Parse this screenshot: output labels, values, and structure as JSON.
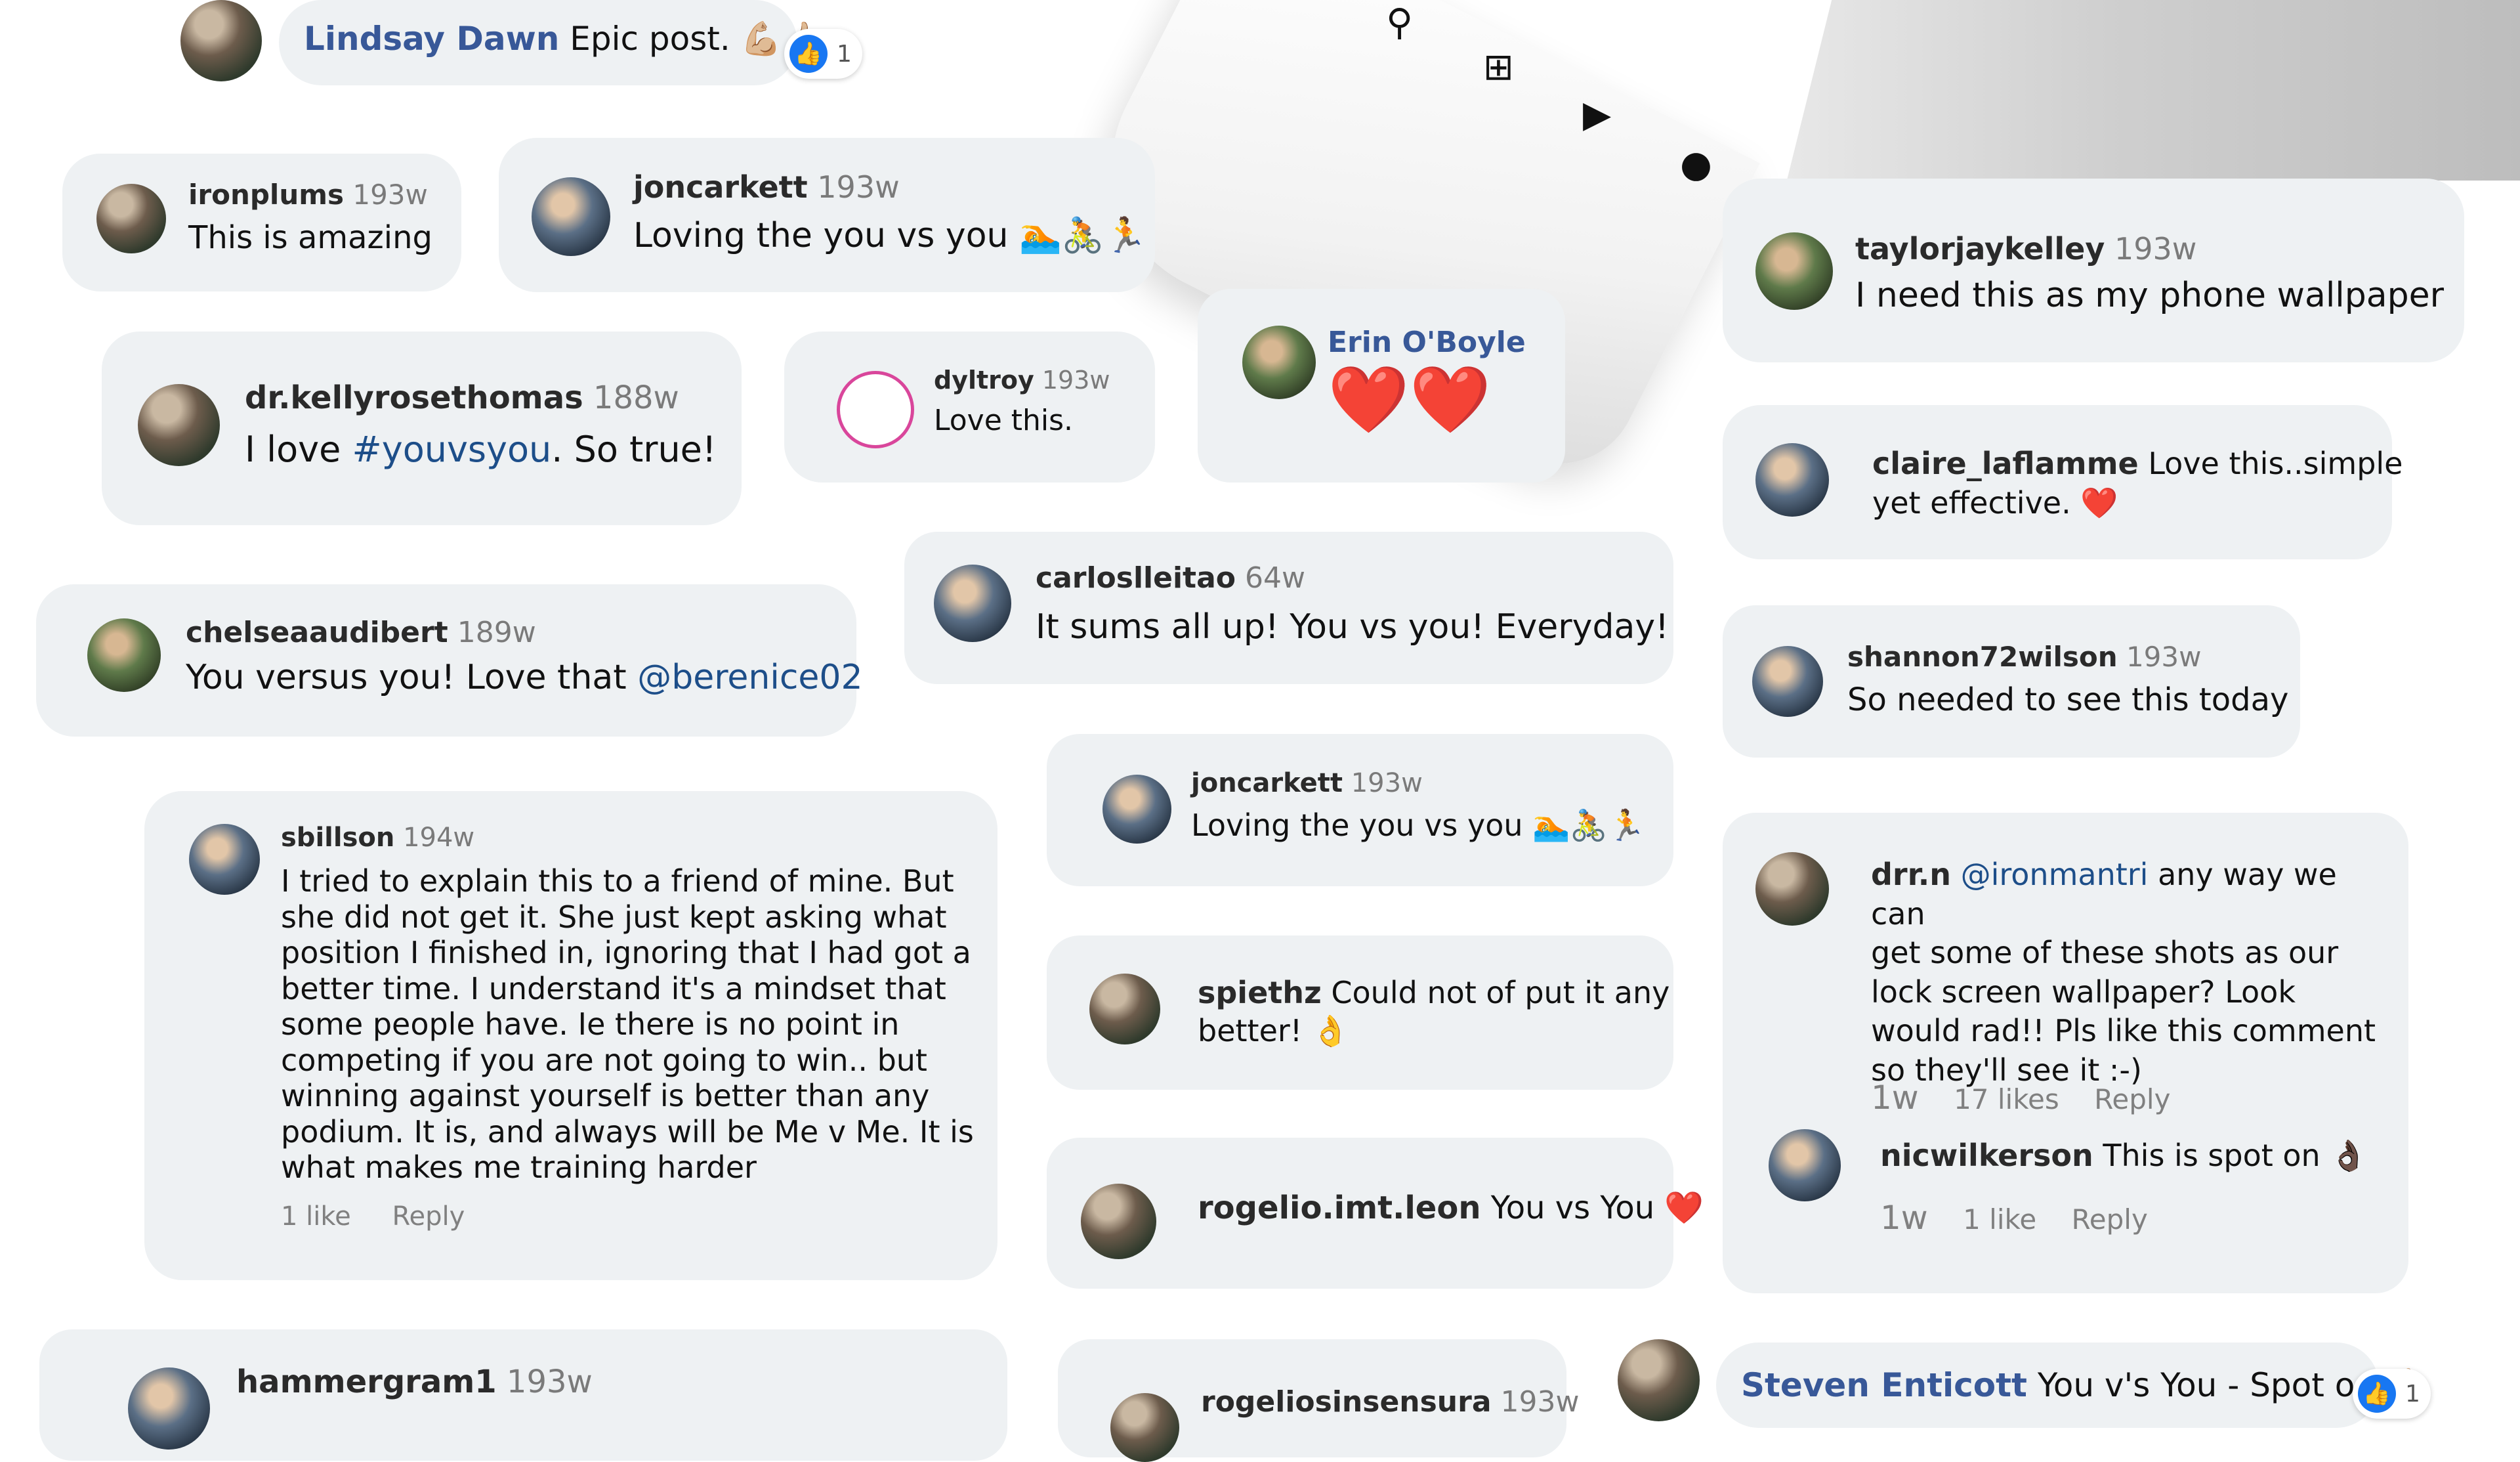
{
  "top_comment": {
    "user": "Lindsay Dawn",
    "text": "Epic post.",
    "emoji": "💪🏼👍🏼",
    "likes": "1"
  },
  "phone_icons": [
    "search-icon",
    "add-icon",
    "reels-icon",
    "profile-icon"
  ],
  "comments": {
    "ironplums": {
      "user": "ironplums",
      "time": "193w",
      "text": "This is amazing"
    },
    "joncarkett1": {
      "user": "joncarkett",
      "time": "193w",
      "text": "Loving the you vs you",
      "emoji": "🏊🚴🏃"
    },
    "taylor": {
      "user": "taylorjaykelley",
      "time": "193w",
      "text": "I need this as my phone wallpaper"
    },
    "kelly": {
      "user": "dr.kellyrosethomas",
      "time": "188w",
      "text_a": "I love ",
      "hashtag": "#youvsyou",
      "text_b": ". So true!"
    },
    "dyltroy": {
      "user": "dyltroy",
      "time": "193w",
      "text": "Love this."
    },
    "erin": {
      "user": "Erin O'Boyle",
      "emoji": "❤️❤️"
    },
    "claire": {
      "user": "claire_laflamme",
      "text_1": "Love this..simple",
      "text_2": "yet effective.",
      "emoji": "❤️"
    },
    "carlos": {
      "user": "carloslleitao",
      "time": "64w",
      "text": "It sums all up! You vs you! Everyday!"
    },
    "chelsea": {
      "user": "chelseaaudibert",
      "time": "189w",
      "text": "You versus you! Love that ",
      "mention": "@berenice02"
    },
    "shannon": {
      "user": "shannon72wilson",
      "time": "193w",
      "text": "So needed to see this today"
    },
    "sbillson": {
      "user": "sbillson",
      "time": "194w",
      "lines": [
        "I tried to explain this to a friend of mine.  But",
        "she did not get it. She just kept asking what",
        "position I finished in, ignoring that I had got a",
        "better time. I understand it's a mindset that",
        "some people have. Ie there is no point in",
        "competing if you are not going to win.. but",
        "winning against yourself is better than any",
        "podium. It is, and always will be Me v Me. It is",
        "what makes me training harder"
      ],
      "likes": "1 like",
      "reply": "Reply"
    },
    "joncarkett2": {
      "user": "joncarkett",
      "time": "193w",
      "text": "Loving the you vs you",
      "emoji": "🏊🚴🏃"
    },
    "drrn": {
      "user": "drr.n",
      "mention": "@ironmantri",
      "lines": [
        "any way we can",
        "get some of these shots as our",
        "lock screen wallpaper? Look",
        "would rad!! Pls like this comment",
        "so they'll see it :-)"
      ],
      "time": "1w",
      "likes": "17 likes",
      "reply": "Reply"
    },
    "spiethz": {
      "user": "spiethz",
      "text_1": "Could not of put it any",
      "text_2": "better!",
      "emoji": "👌"
    },
    "nicwilkerson": {
      "user": "nicwilkerson",
      "text": "This is spot on",
      "emoji": "👌🏿",
      "time": "1w",
      "likes": "1 like",
      "reply": "Reply"
    },
    "rogelio": {
      "user": "rogelio.imt.leon",
      "text": "You vs You",
      "emoji": "❤️"
    },
    "hammergram": {
      "user": "hammergram1",
      "time": "193w"
    },
    "rogeliosinsensura": {
      "user": "rogeliosinsensura",
      "time": "193w"
    },
    "steven": {
      "user": "Steven Enticott",
      "text": "You v's You - Spot on",
      "emoji": "👍🏼",
      "likes": "1"
    }
  }
}
